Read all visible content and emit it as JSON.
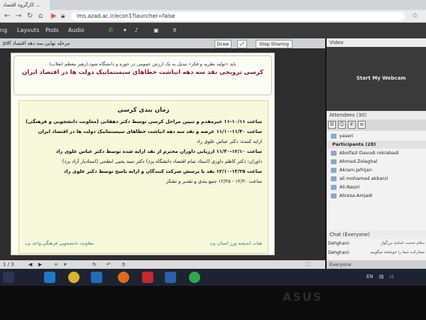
{
  "browser": {
    "tab_title": "کارگروه اقتصاد ...",
    "url": "lms.azad.ac.ir/econ1?launcher=false"
  },
  "appbar": {
    "menus": [
      "Layouts",
      "Pods",
      "Audio"
    ]
  },
  "presentation": {
    "file_name": "pdf مرحله نهایی سه دهه اقتصاد",
    "draw_label": "Draw",
    "stop_sharing_label": "Stop Sharing",
    "slide": {
      "quote": "باید «تولید نظریه و فکر» تبدیل به یک ارزش عمومی در حوزه و دانشگاه شود.(رهبر معظم انقلاب)",
      "title": "کرسی ترویجی نقد سه دهه انباشت خطاهای سیستماتیک دولت ها در اقتصاد ایران",
      "schedule_title": "زمان بندی کرسی",
      "lines": [
        "ساعت ۱۰/۱۱-۱۱    خیرمقدم و تبیین مراحل کرسی توسط دکتر دهقانی (معاونت دانشجویی و فرهنگی)",
        "ساعت ۱۱/۴۰-۱۱/۱۰ عرضه و نقد سه دهه انباشت خطاهای سیستماتیک دولت ها در اقتصاد ایران",
        "ارایه کننده: دکتر عباس علوی راد",
        "ساعت ۱۲/۱۰-۱۱/۴۰ ارزیابی داوران محترم از نقد ارایه شده توسط دکتر عباس علوی راد",
        "داوران: دکتر کاظم داوری (استاد تمام اقتصاد دانشگاه یزد) دکتر سید یحیی ابطحی (استادیار آزاد یزد)",
        "ساعت ۱۲/۲۵-۱۲/۱۰ نقد یا پرسش شرکت کنندگان و ارایه پاسخ توسط دکتر علوی راد",
        "ساعت ۱۲/۳۰ - ۱۲/۲۵    جمع بندی و تقدیر و تشکر"
      ],
      "footer_right": "هیات اندیشه ورز استان یزد",
      "footer_left": "معاونت دانشجویی فرهنگی واحد یزد"
    },
    "page_label": "1 / 3"
  },
  "video": {
    "header": "Video",
    "webcam_label": "Start My Webcam"
  },
  "attendees": {
    "header": "Attendees",
    "count": "(30)",
    "host": "yaseri",
    "participants_label": "Participants (28)",
    "participants": [
      "Abolfazl Davudi rokrabadi",
      "Ahmad.Zolaghal",
      "Akram.Jafrijan",
      "ali mohamad akbarzi",
      "Ali.Nasiri",
      "Alireza.Amjadi"
    ]
  },
  "chat": {
    "header": "Chat",
    "scope": "(Everyone)",
    "messages": [
      {
        "sender": "Dehghani:",
        "text": "سلام خدمت اساتید بزرگوار"
      },
      {
        "sender": "Dehghani:",
        "text": "مشارکت شما را خوشامد میگوییم"
      }
    ],
    "footer": "Everyone"
  },
  "taskbar": {
    "lang": "EN"
  },
  "bezel": {
    "brand": "ASUS"
  }
}
